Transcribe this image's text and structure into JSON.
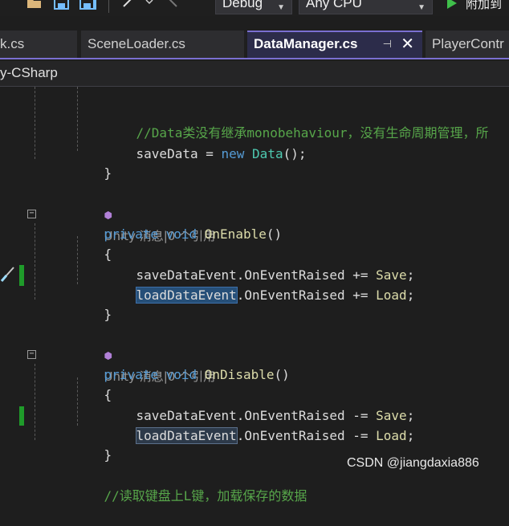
{
  "toolbar": {
    "configuration": "Debug",
    "platform": "Any CPU",
    "run_label": "附加到"
  },
  "tabs": [
    {
      "label": "k.cs"
    },
    {
      "label": "SceneLoader.cs"
    },
    {
      "label": "DataManager.cs",
      "active": true
    },
    {
      "label": "PlayerContr"
    }
  ],
  "project": "y-CSharp",
  "code": {
    "l1_comment": "//Data类没有继承monobehaviour，没有生命周期管理，所",
    "l2_var": "saveData",
    "l2_eq": " = ",
    "l2_new": "new",
    "l2_type": "Data",
    "l2_end": "();",
    "brace_close": "}",
    "brace_open": "{",
    "meta1": "Unity 消息|0 个引用",
    "kw_private": "private",
    "kw_void": "void",
    "m_onenable": "OnEnable",
    "parens": "()",
    "save_event": "saveDataEvent",
    "load_event": "loadDataEvent",
    "raised": ".OnEventRaised",
    "plus_eq": " += ",
    "minus_eq": " -= ",
    "save_fn": "Save",
    "load_fn": "Load",
    "semi": ";",
    "meta2": "Unity 消息|0 个引用",
    "m_ondisable": "OnDisable",
    "last_comment": "//读取键盘上L键，加载保存的数据"
  },
  "watermark": "CSDN @jiangdaxia886",
  "colors": {
    "comment": "#57a64a",
    "keyword": "#569cd6",
    "type": "#4ec9b0",
    "method": "#dcdcaa",
    "accent": "#7a6fd1",
    "change_bar": "#1f9b2a"
  }
}
